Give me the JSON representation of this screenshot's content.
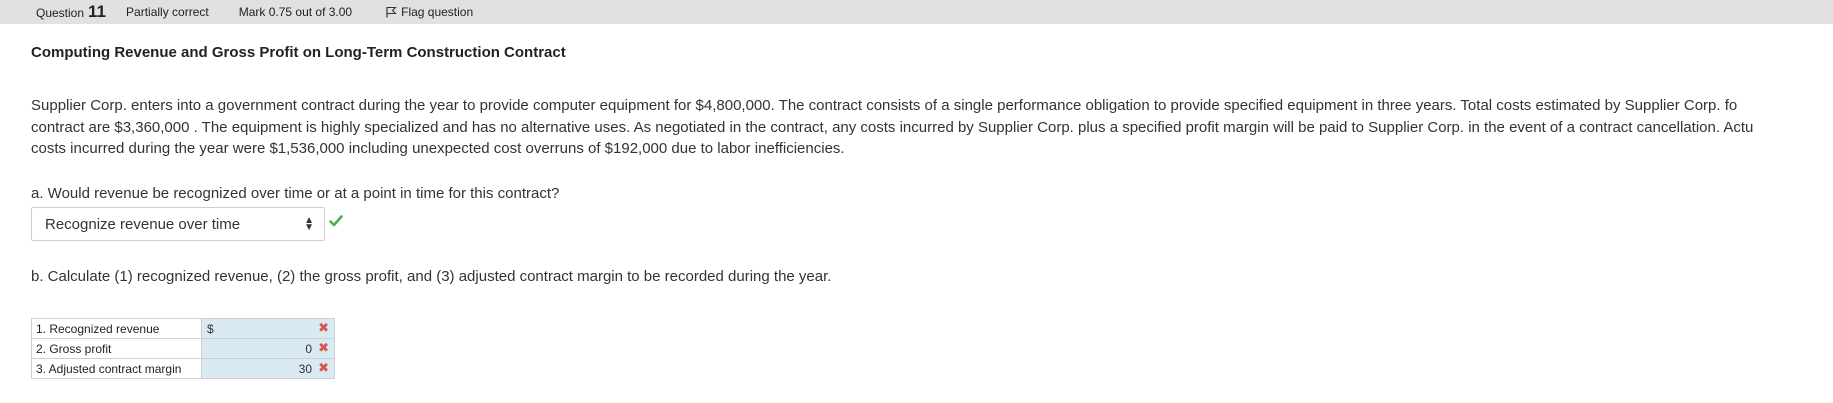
{
  "header": {
    "question_label": "Question",
    "question_number": "11",
    "state": "Partially correct",
    "mark": "Mark 0.75 out of 3.00",
    "flag_label": "Flag question"
  },
  "title": "Computing Revenue and Gross Profit on Long-Term Construction Contract",
  "paragraph_lines": [
    "Supplier Corp. enters into a government contract during the year to provide computer equipment for $4,800,000. The contract consists of a single performance obligation to provide specified equipment in three years. Total costs estimated by Supplier Corp. fo",
    "contract are $3,360,000 . The equipment is highly specialized and has no alternative uses. As negotiated in the contract, any costs incurred by Supplier Corp. plus a specified profit margin will be paid to Supplier Corp. in the event of a contract cancellation. Actu",
    "costs incurred during the year were $1,536,000 including unexpected cost overruns of $192,000 due to labor inefficiencies."
  ],
  "part_a": {
    "question": "a. Would revenue be recognized over time or at a point in time for this contract?",
    "selected": "Recognize revenue over time"
  },
  "part_b": {
    "question": "b. Calculate (1) recognized revenue, (2) the gross profit, and (3) adjusted contract margin to be recorded during the year."
  },
  "answers": [
    {
      "label": "1. Recognized revenue",
      "currency": "$",
      "value": ""
    },
    {
      "label": "2. Gross profit",
      "currency": "",
      "value": "0"
    },
    {
      "label": "3. Adjusted contract margin",
      "currency": "",
      "value": "30"
    }
  ],
  "colors": {
    "check": "#4cae4c",
    "cross": "#d9534f",
    "input_bg": "#d9eaf2"
  }
}
